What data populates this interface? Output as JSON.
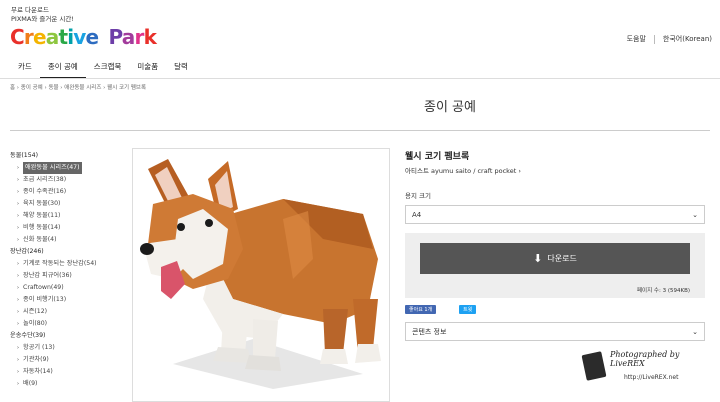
{
  "header": {
    "tagline_1": "무료 다운로드",
    "tagline_2": "PIXMA와 즐거운 시간!",
    "logo_letters": [
      {
        "ch": "C",
        "color": "#e9302a"
      },
      {
        "ch": "r",
        "color": "#f07d1a"
      },
      {
        "ch": "e",
        "color": "#f4b400"
      },
      {
        "ch": "a",
        "color": "#8dc63f"
      },
      {
        "ch": "t",
        "color": "#2aa847"
      },
      {
        "ch": "i",
        "color": "#00a0a8"
      },
      {
        "ch": "v",
        "color": "#1aa3e2"
      },
      {
        "ch": "e",
        "color": "#2d6cc0"
      },
      {
        "ch": " ",
        "color": "#000000"
      },
      {
        "ch": "P",
        "color": "#6d3ea8"
      },
      {
        "ch": "a",
        "color": "#a23c9c"
      },
      {
        "ch": "r",
        "color": "#e0338c"
      },
      {
        "ch": "k",
        "color": "#e9302a"
      }
    ],
    "help": "도움말",
    "language": "한국어(Korean)"
  },
  "nav": {
    "tabs": [
      "카드",
      "종이 공예",
      "스크랩북",
      "미술품",
      "달력"
    ],
    "active_index": 1
  },
  "breadcrumb": "홈 › 종이 공예 › 동물 › 애완동물 시리즈 › 웰시 코기 펨브록",
  "page_title": "종이 공예",
  "sidebar": [
    {
      "type": "cat",
      "label": "동물(154)"
    },
    {
      "type": "item",
      "label": "애완동물 시리즈(47)",
      "selected": true
    },
    {
      "type": "item",
      "label": "초급 시리즈(38)"
    },
    {
      "type": "item",
      "label": "종이 수족관(16)"
    },
    {
      "type": "item",
      "label": "육지 동물(30)"
    },
    {
      "type": "item",
      "label": "해양 동물(11)"
    },
    {
      "type": "item",
      "label": "비행 동물(14)"
    },
    {
      "type": "item",
      "label": "신화 동물(4)"
    },
    {
      "type": "cat",
      "label": "장난감(246)"
    },
    {
      "type": "item",
      "label": "기계로 작동되는 장난감(54)"
    },
    {
      "type": "item",
      "label": "장난감 피규어(36)"
    },
    {
      "type": "item",
      "label": "Craftown(49)"
    },
    {
      "type": "item",
      "label": "종이 비행기(13)"
    },
    {
      "type": "item",
      "label": "시즌(12)"
    },
    {
      "type": "item",
      "label": "놀이(80)"
    },
    {
      "type": "cat",
      "label": "운송수단(39)"
    },
    {
      "type": "item",
      "label": "항공기 (13)"
    },
    {
      "type": "item",
      "label": "기관차(9)"
    },
    {
      "type": "item",
      "label": "자동차(14)"
    },
    {
      "type": "item",
      "label": "배(9)"
    }
  ],
  "product": {
    "title": "웰시 코기 펨브록",
    "artist": "아티스트 ayumu saito / craft pocket",
    "size_label": "용지 크기",
    "size_value": "A4",
    "download_label": "다운로드",
    "pages_info": "페이지 수: 3 (594KB)",
    "like_label": "좋아요 1개",
    "tweet_label": "트윗",
    "contents_label": "콘텐츠 정보"
  },
  "watermark": {
    "text": "Photographed by LiveREX",
    "url": "http://LiveREX.net"
  }
}
